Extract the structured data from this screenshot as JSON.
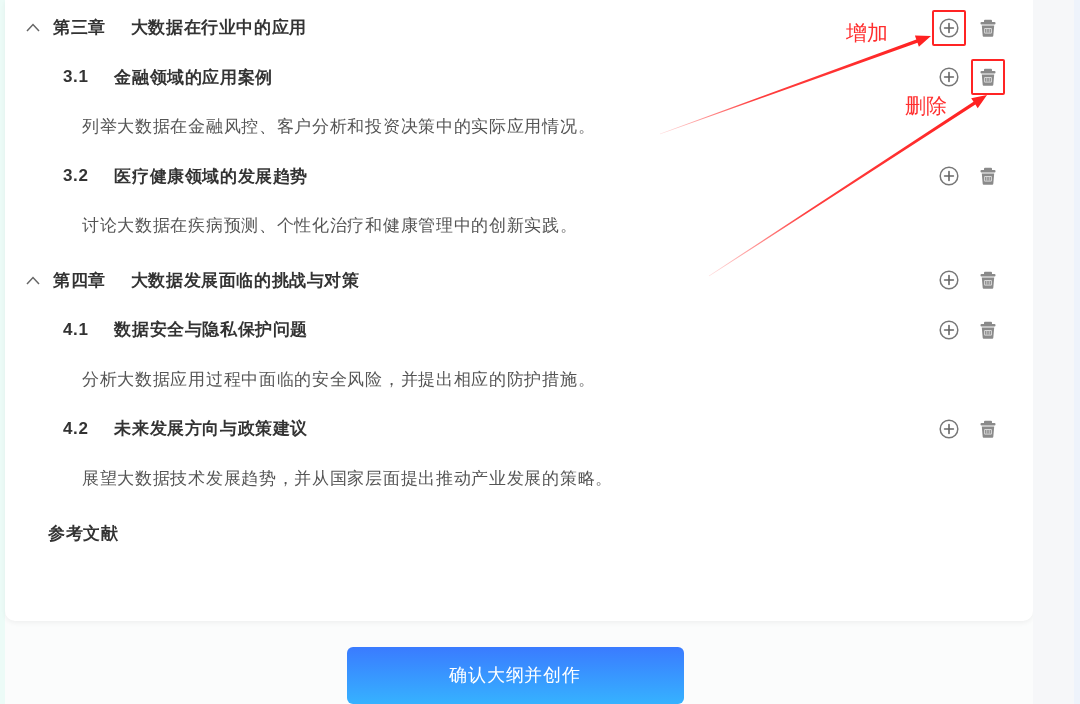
{
  "outline": {
    "chapters": [
      {
        "number": "第三章",
        "title": "大数据在行业中的应用",
        "expanded": true,
        "actions": [
          {
            "kind": "add",
            "highlighted": true
          },
          {
            "kind": "delete",
            "highlighted": false
          }
        ],
        "sections": [
          {
            "number": "3.1",
            "title": "金融领域的应用案例",
            "actions": [
              {
                "kind": "add",
                "highlighted": false
              },
              {
                "kind": "delete",
                "highlighted": true
              }
            ],
            "description": "列举大数据在金融风控、客户分析和投资决策中的实际应用情况。"
          },
          {
            "number": "3.2",
            "title": "医疗健康领域的发展趋势",
            "actions": [
              {
                "kind": "add",
                "highlighted": false
              },
              {
                "kind": "delete",
                "highlighted": false
              }
            ],
            "description": "讨论大数据在疾病预测、个性化治疗和健康管理中的创新实践。"
          }
        ]
      },
      {
        "number": "第四章",
        "title": "大数据发展面临的挑战与对策",
        "expanded": true,
        "actions": [
          {
            "kind": "add",
            "highlighted": false
          },
          {
            "kind": "delete",
            "highlighted": false
          }
        ],
        "sections": [
          {
            "number": "4.1",
            "title": "数据安全与隐私保护问题",
            "actions": [
              {
                "kind": "add",
                "highlighted": false
              },
              {
                "kind": "delete",
                "highlighted": false
              }
            ],
            "description": "分析大数据应用过程中面临的安全风险，并提出相应的防护措施。"
          },
          {
            "number": "4.2",
            "title": "未来发展方向与政策建议",
            "actions": [
              {
                "kind": "add",
                "highlighted": false
              },
              {
                "kind": "delete",
                "highlighted": false
              }
            ],
            "description": "展望大数据技术发展趋势，并从国家层面提出推动产业发展的策略。"
          }
        ]
      }
    ],
    "references": {
      "title": "参考文献"
    }
  },
  "confirm_button": {
    "label": "确认大纲并创作"
  },
  "annotations": [
    {
      "label": "增加"
    },
    {
      "label": "删除"
    }
  ]
}
